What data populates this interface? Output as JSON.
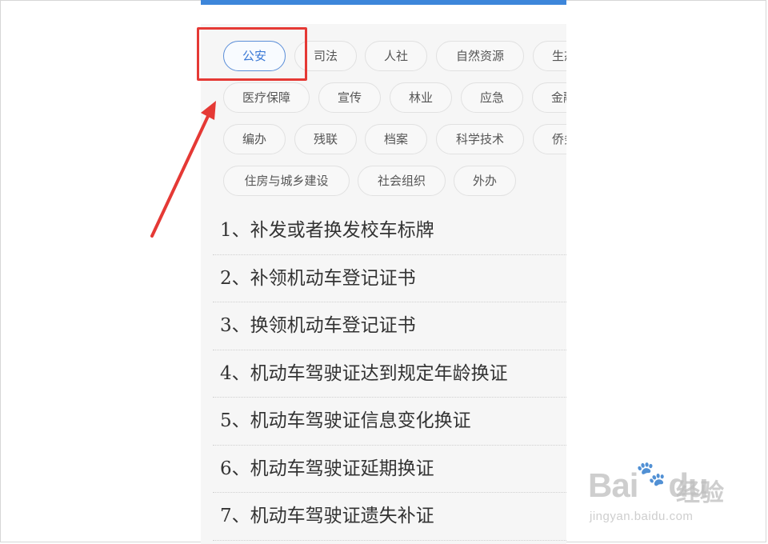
{
  "categories": [
    {
      "label": "公安",
      "active": true
    },
    {
      "label": "司法",
      "active": false
    },
    {
      "label": "人社",
      "active": false
    },
    {
      "label": "自然资源",
      "active": false
    },
    {
      "label": "生态",
      "active": false
    },
    {
      "label": "医疗保障",
      "active": false
    },
    {
      "label": "宣传",
      "active": false
    },
    {
      "label": "林业",
      "active": false
    },
    {
      "label": "应急",
      "active": false
    },
    {
      "label": "金融",
      "active": false
    },
    {
      "label": "编办",
      "active": false
    },
    {
      "label": "残联",
      "active": false
    },
    {
      "label": "档案",
      "active": false
    },
    {
      "label": "科学技术",
      "active": false
    },
    {
      "label": "侨务",
      "active": false
    },
    {
      "label": "住房与城乡建设",
      "active": false
    },
    {
      "label": "社会组织",
      "active": false
    },
    {
      "label": "外办",
      "active": false
    }
  ],
  "services": [
    "1、补发或者换发校车标牌",
    "2、补领机动车登记证书",
    "3、换领机动车登记证书",
    "4、机动车驾驶证达到规定年龄换证",
    "5、机动车驾驶证信息变化换证",
    "6、机动车驾驶证延期换证",
    "7、机动车驾驶证遗失补证"
  ],
  "watermark": {
    "logo": "Bai",
    "logo_tail": "du",
    "cn": "经验",
    "url": "jingyan.baidu.com"
  },
  "colors": {
    "accent": "#3d86da",
    "highlight": "#e53935",
    "active_chip_border": "#5b8ed8"
  }
}
